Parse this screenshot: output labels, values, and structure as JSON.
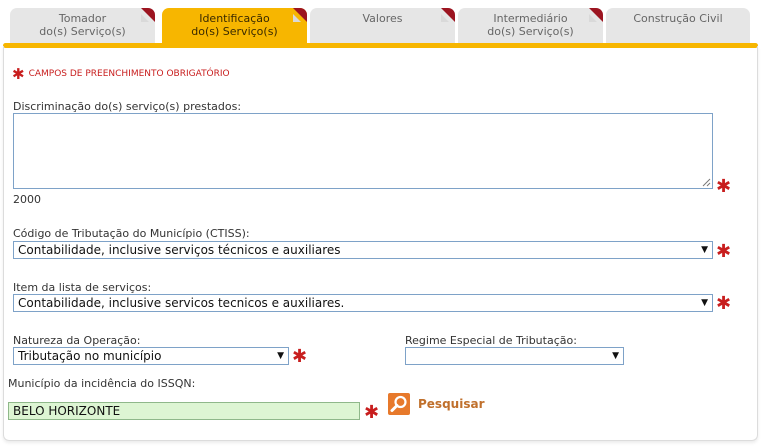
{
  "tabs": [
    {
      "line1": "Tomador",
      "line2": "do(s) Serviço(s)"
    },
    {
      "line1": "Identificação",
      "line2": "do(s) Serviço(s)"
    },
    {
      "line1": "Valores",
      "line2": ""
    },
    {
      "line1": "Intermediário",
      "line2": "do(s) Serviço(s)"
    },
    {
      "line1": "Construção Civil",
      "line2": ""
    }
  ],
  "required_note": "CAMPOS DE PREENCHIMENTO OBRIGATÓRIO",
  "discriminacao": {
    "label": "Discriminação do(s) serviço(s) prestados:",
    "value": "",
    "counter": "2000"
  },
  "ctiss": {
    "label": "Código de Tributação do Município (CTISS):",
    "selected": "Contabilidade, inclusive serviços técnicos e auxiliares"
  },
  "item_lista": {
    "label": "Item da lista de serviços:",
    "selected": "Contabilidade, inclusive servicos tecnicos e auxiliares."
  },
  "natureza": {
    "label": "Natureza da Operação:",
    "selected": "Tributação no município"
  },
  "regime": {
    "label": "Regime Especial de Tributação:",
    "selected": ""
  },
  "municipio": {
    "label": "Município da incidência do ISSQN:",
    "value": "BELO HORIZONTE"
  },
  "search_button": "Pesquisar",
  "colors": {
    "active_tab": "#f7b600",
    "required": "#c81e1e",
    "search_icon": "#e7792b"
  }
}
